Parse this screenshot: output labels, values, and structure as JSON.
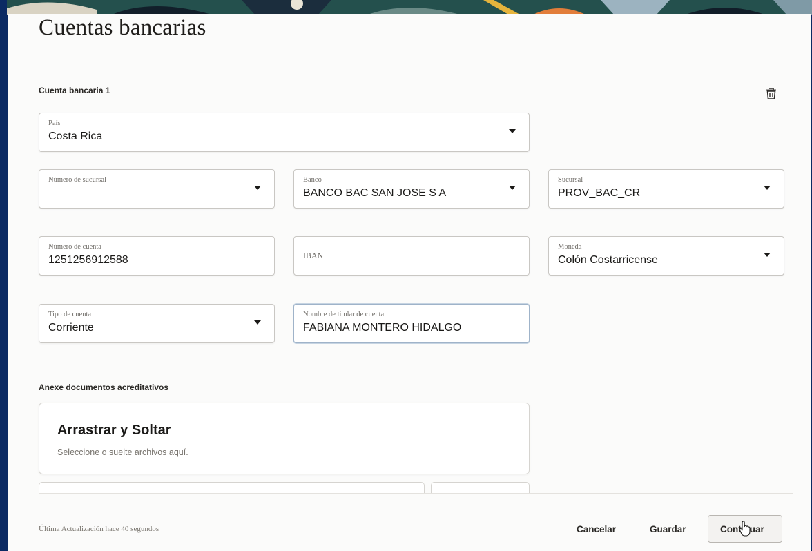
{
  "page": {
    "title": "Cuentas bancarias"
  },
  "account_section": {
    "label": "Cuenta bancaria 1",
    "delete_icon": "trash-icon"
  },
  "fields": {
    "pais": {
      "label": "País",
      "value": "Costa Rica"
    },
    "numero_sucursal": {
      "label": "Número de sucursal",
      "value": ""
    },
    "banco": {
      "label": "Banco",
      "value": "BANCO BAC SAN JOSE S A"
    },
    "sucursal": {
      "label": "Sucursal",
      "value": "PROV_BAC_CR"
    },
    "numero_cuenta": {
      "label": "Número de cuenta",
      "value": "1251256912588"
    },
    "iban": {
      "label": "IBAN",
      "value": ""
    },
    "moneda": {
      "label": "Moneda",
      "value": "Colón Costarricense"
    },
    "tipo_cuenta": {
      "label": "Tipo de cuenta",
      "value": "Corriente"
    },
    "titular": {
      "label": "Nombre de titular de cuenta",
      "value": "FABIANA MONTERO HIDALGO"
    }
  },
  "attachments": {
    "label": "Anexe documentos acreditativos",
    "dropzone_title": "Arrastrar y Soltar",
    "dropzone_hint": "Seleccione o suelte archivos aquí."
  },
  "footer": {
    "last_update": "Última Actualización hace 40 segundos",
    "cancel": "Cancelar",
    "save": "Guardar",
    "continue": "Continuar"
  },
  "colors": {
    "background": "#0b2a63",
    "panel": "#fbfbfa",
    "border": "#c9c7c3"
  }
}
